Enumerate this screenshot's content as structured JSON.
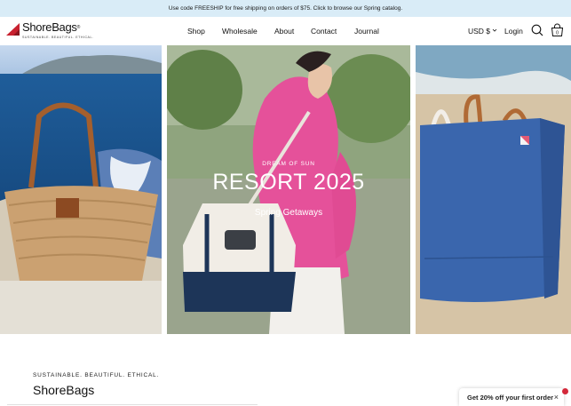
{
  "announcement": {
    "text": "Use code FREESHIP for free shipping on orders of $75. Click to browse our Spring catalog."
  },
  "header": {
    "logo_name": "ShoreBags",
    "logo_trademark": "®",
    "logo_tagline": "SUSTAINABLE. BEAUTIFUL. ETHICAL.",
    "nav": [
      "Shop",
      "Wholesale",
      "About",
      "Contact",
      "Journal"
    ],
    "currency": "USD $",
    "login": "Login",
    "cart_count": "0"
  },
  "hero": {
    "eyebrow": "DREAM OF SUN",
    "title": "RESORT 2025",
    "subtitle": "Spring Getaways"
  },
  "intro": {
    "tagline": "SUSTAINABLE. BEAUTIFUL. ETHICAL.",
    "heading": "ShoreBags"
  },
  "promo": {
    "text": "Get 20% off your first order",
    "close": "×"
  },
  "colors": {
    "announcement_bg": "#d9ecf7",
    "logo_red": "#c8212f",
    "promo_dot": "#d3283a"
  },
  "icons": [
    "search-icon",
    "cart-icon",
    "close-icon",
    "chevron-down-icon"
  ]
}
